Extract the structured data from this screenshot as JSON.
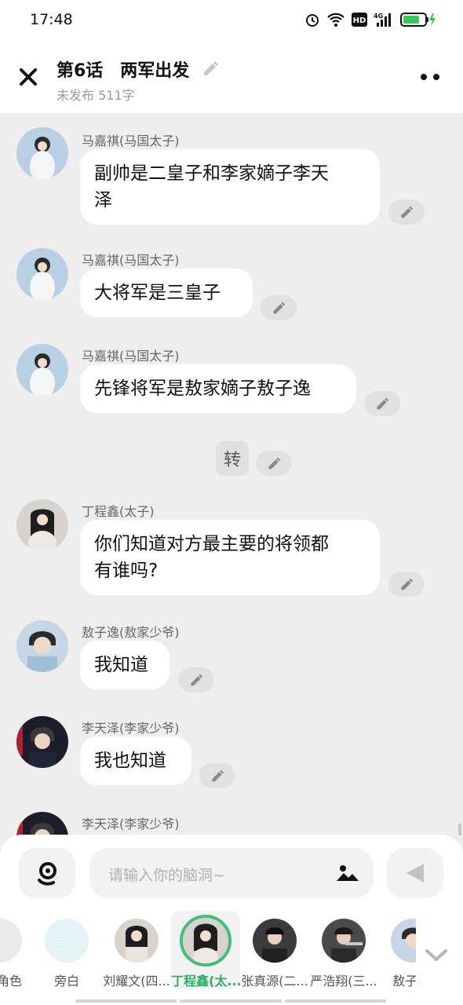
{
  "status_bar": {
    "time": "17:48"
  },
  "header": {
    "title": "第6话　两军出发",
    "subtitle": "未发布 511字"
  },
  "messages": [
    {
      "speaker": "马嘉祺(马国太子)",
      "lines": [
        "副帅是二皇子和李家嫡子李天",
        "泽"
      ]
    },
    {
      "speaker": "马嘉祺(马国太子)",
      "lines": [
        "大将军是三皇子"
      ]
    },
    {
      "speaker": "马嘉祺(马国太子)",
      "lines": [
        "先锋将军是敖家嫡子敖子逸"
      ]
    },
    {
      "narration": "转"
    },
    {
      "speaker": "丁程鑫(太子)",
      "lines": [
        "你们知道对方最主要的将领都",
        "有谁吗?"
      ]
    },
    {
      "speaker": "敖子逸(敖家少爷)",
      "lines": [
        "我知道"
      ]
    },
    {
      "speaker": "李天泽(李家少爷)",
      "lines": [
        "我也知道"
      ]
    },
    {
      "speaker": "李天泽(李家少爷)",
      "lines": []
    }
  ],
  "input": {
    "placeholder": "请输入你的脑洞~"
  },
  "roles": [
    {
      "label": "角色",
      "visible_label": "角色"
    },
    {
      "label": "旁白",
      "avatar_text": "旁白"
    },
    {
      "label": "刘耀文(四..."
    },
    {
      "label": "丁程鑫(太...",
      "selected": true
    },
    {
      "label": "张真源(二..."
    },
    {
      "label": "严浩翔(三..."
    },
    {
      "label": "敖子逸"
    }
  ],
  "colors": {
    "accent_green": "#3fbf7a",
    "bubble": "#ffffff",
    "background": "#eeeeee"
  },
  "icons": [
    "close-icon",
    "pencil-icon",
    "more-icon",
    "voice-icon",
    "image-icon",
    "send-icon",
    "chevron-down-icon"
  ]
}
